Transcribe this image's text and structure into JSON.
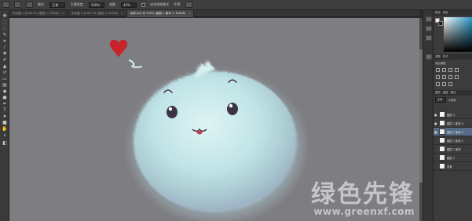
{
  "options_bar": {
    "mode_label": "模式:",
    "mode_value": "正常",
    "opacity_label": "不透明度:",
    "opacity_value": "100%",
    "flow_label": "流量:",
    "flow_value": "43%",
    "airbrush_label": "启用喷枪模式",
    "smoothing_label": "平滑:"
  },
  "tabs": [
    {
      "label": "未标题-1 @ 66.7% (图层 2, RGB/8)",
      "active": false
    },
    {
      "label": "未标题-1 @ 66.7% (图层 3, RGB/8)",
      "active": false
    },
    {
      "label": "毛球.psd @ 200% (图层 1 副本 3, RGB/8)",
      "active": true
    }
  ],
  "panels": {
    "color_tabs": [
      "颜色",
      "色板"
    ],
    "adjust_tabs": [
      "调整",
      "样式"
    ],
    "adjust_title": "添加调整",
    "layers_tabs": [
      "图层",
      "通道",
      "路径"
    ],
    "blend_mode": "正常",
    "opacity_short": "不透明",
    "layers": [
      {
        "name": "图层 3",
        "visible": true,
        "selected": false
      },
      {
        "name": "图层 1 副本 4",
        "visible": true,
        "selected": false
      },
      {
        "name": "图层 1 副本 3",
        "visible": true,
        "selected": true
      },
      {
        "name": "图层 1 副本 2",
        "visible": false,
        "selected": false
      },
      {
        "name": "图层 1 副本",
        "visible": false,
        "selected": false
      },
      {
        "name": "图层 1",
        "visible": false,
        "selected": false
      },
      {
        "name": "背景",
        "visible": false,
        "selected": false
      }
    ]
  },
  "watermark": {
    "title": "绿色先锋",
    "url": "www.greenxf.com"
  },
  "colors": {
    "canvas_bg": "#7e7d81",
    "fur": "#bfe3e6",
    "heart": "#c8242d",
    "selected_layer": "#566b86"
  }
}
